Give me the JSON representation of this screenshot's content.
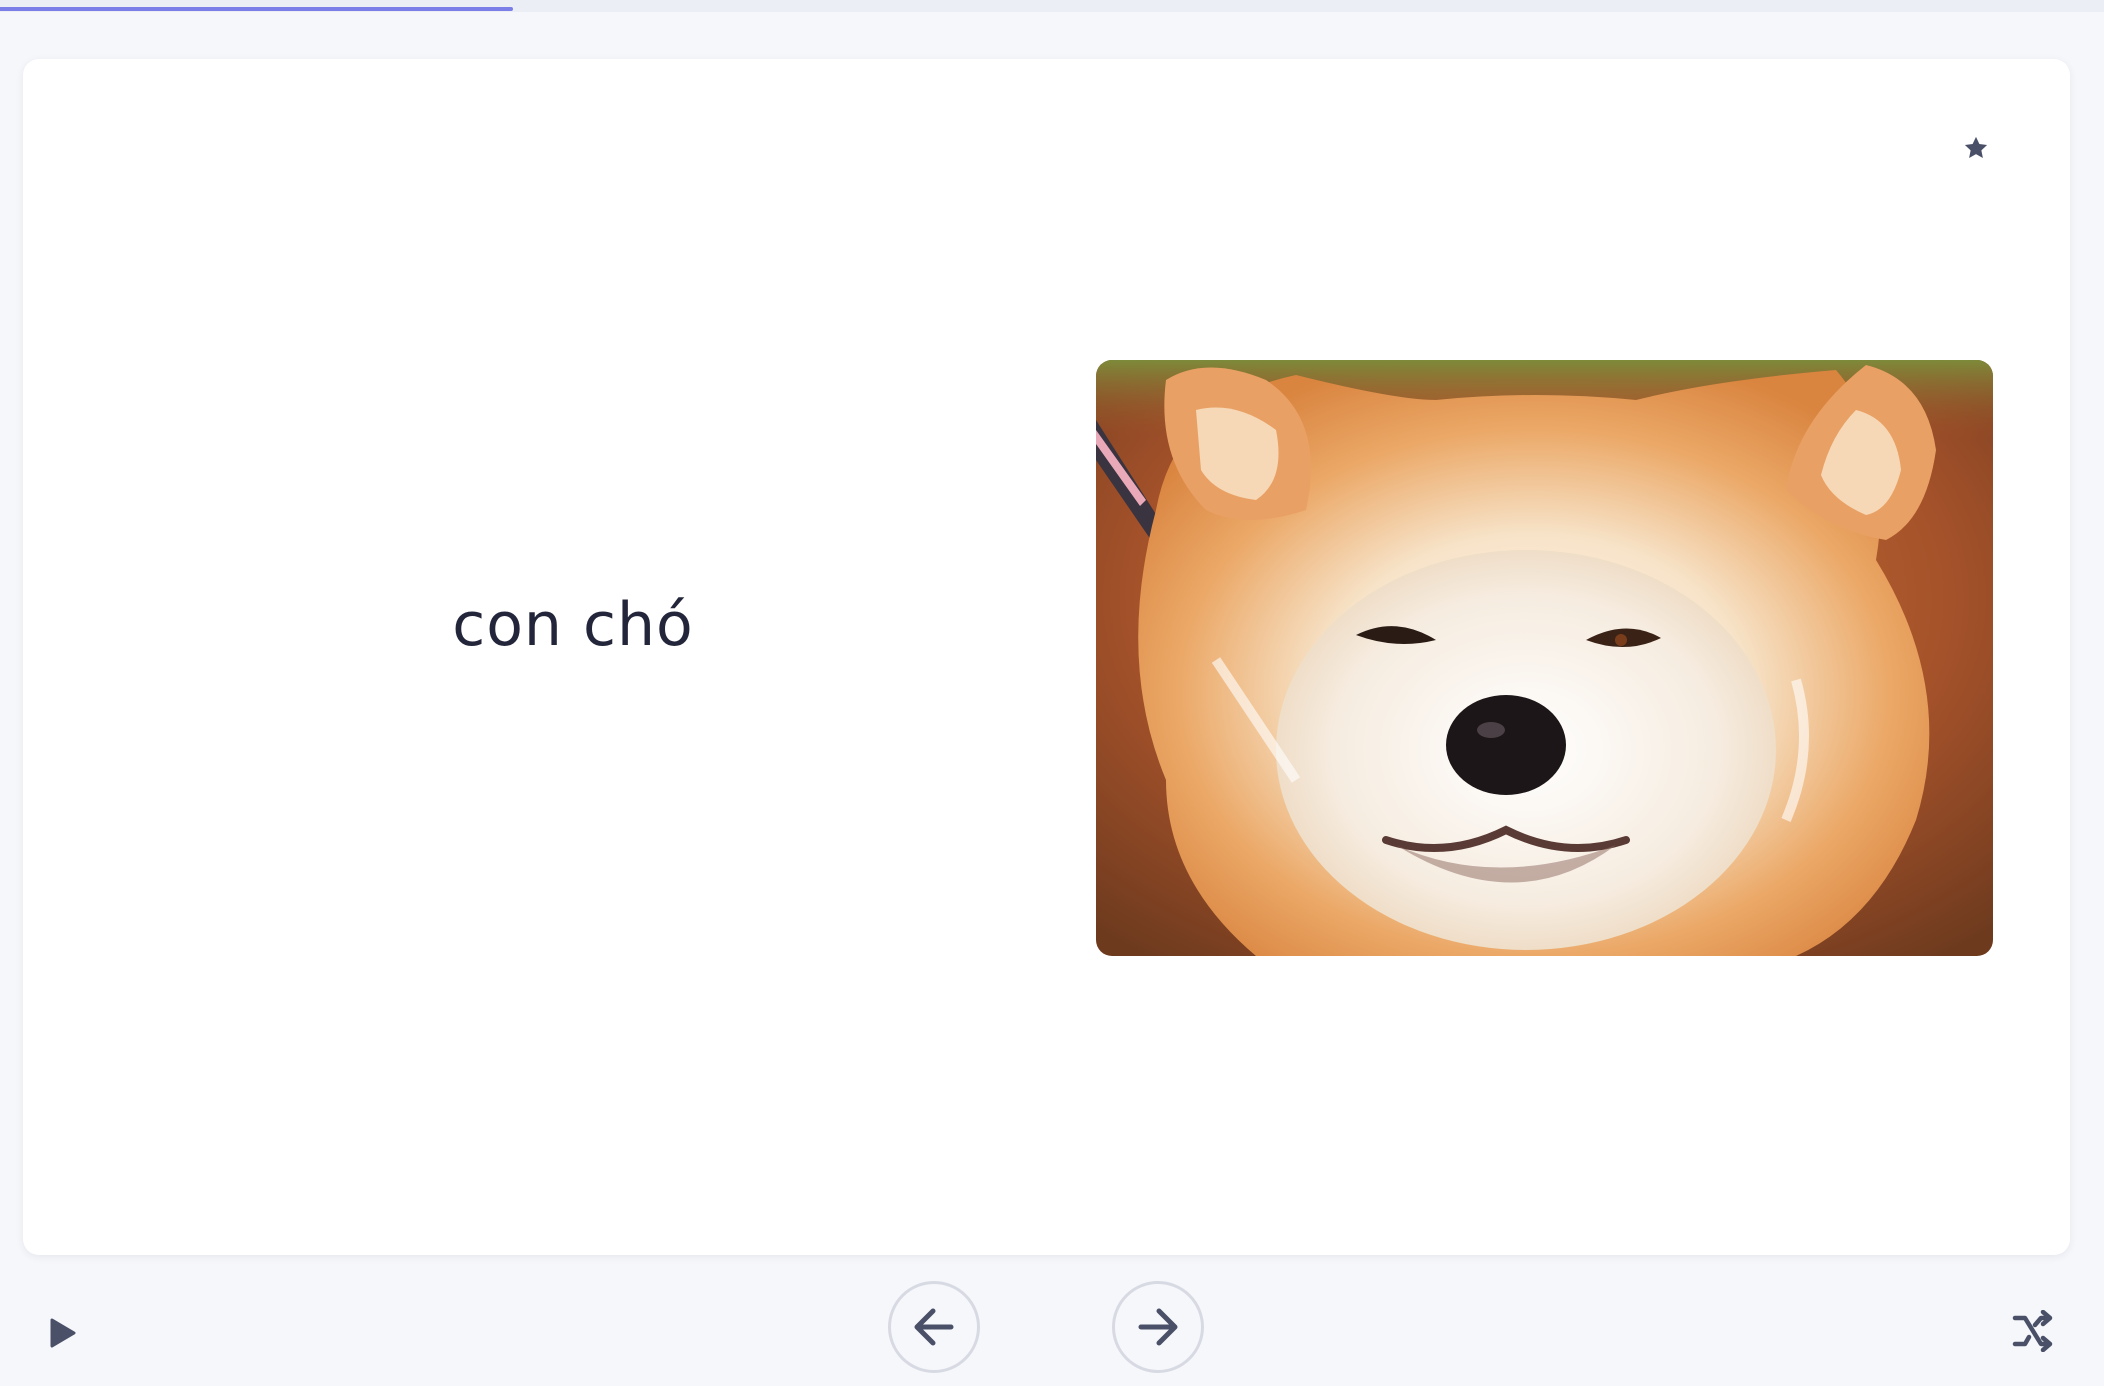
{
  "progress": {
    "fraction": 0.244,
    "color": "#7b7ee6"
  },
  "card": {
    "term": "con chó",
    "image": {
      "subject": "dog",
      "description_icon": "dog-photo"
    },
    "star_icon": "star-icon",
    "accent_color": "#4a5068"
  },
  "controls": {
    "play_icon": "play-icon",
    "prev_icon": "arrow-left-icon",
    "next_icon": "arrow-right-icon",
    "shuffle_icon": "shuffle-icon",
    "icon_color": "#4a5068"
  }
}
